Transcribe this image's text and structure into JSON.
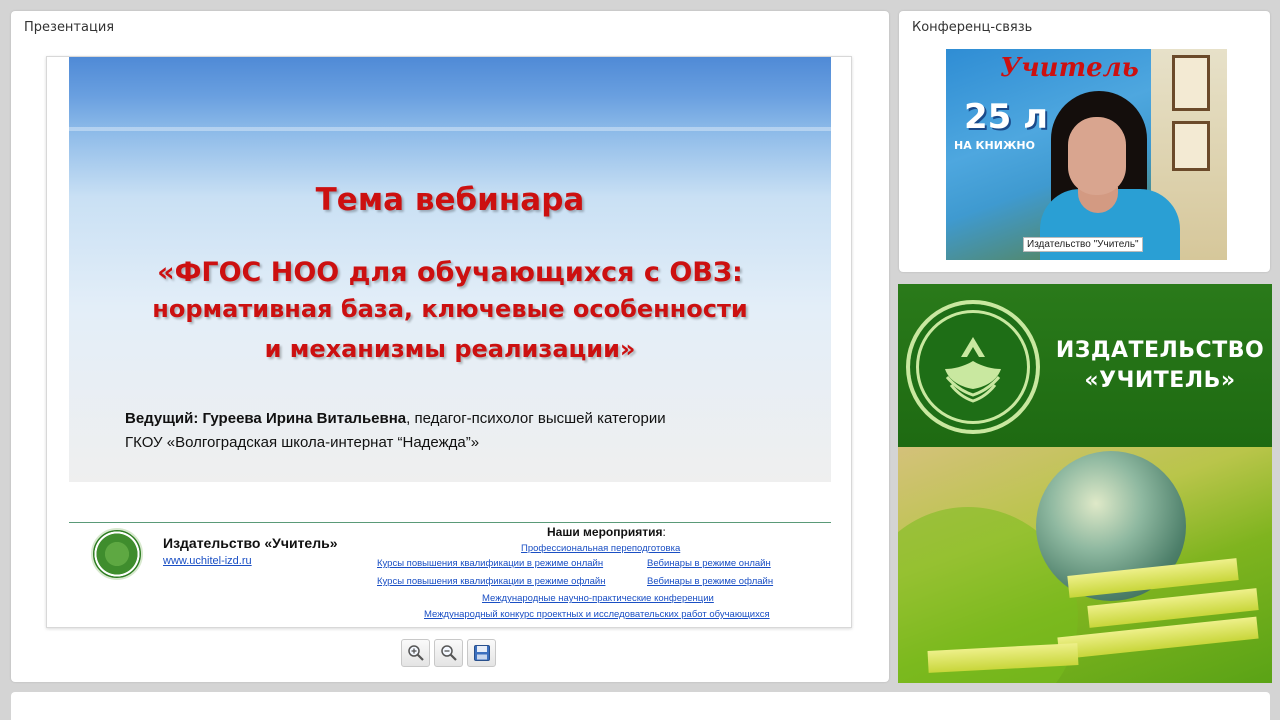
{
  "presentation": {
    "panel_title": "Презентация",
    "slide": {
      "topic": "Тема вебинара",
      "title_line1": "«ФГОС НОО для обучающихся с ОВЗ:",
      "title_line2": "нормативная база, ключевые особенности",
      "title_line3": "и механизмы реализации»",
      "presenter_label": "Ведущий: Гуреева Ирина Витальевна",
      "presenter_role": ", педагог-психолог высшей категории",
      "presenter_org": "ГКОУ «Волгоградская школа-интернат “Надежда”»",
      "footer": {
        "publisher": "Издательство «Учитель»",
        "url": "www.uchitel-izd.ru",
        "events_title": "Наши мероприятия",
        "events_colon": ":",
        "events": [
          "Профессиональная переподготовка",
          "Курсы повышения квалификации в режиме онлайн",
          "Вебинары в режиме онлайн",
          "Курсы повышения квалификации в режиме офлайн",
          "Вебинары в режиме офлайн",
          "Международные научно-практические конференции",
          "Международный конкурс проектных и исследовательских работ обучающихся"
        ]
      }
    },
    "controls": {
      "zoom_in_icon": "zoom-in-icon",
      "zoom_out_icon": "zoom-out-icon",
      "save_icon": "floppy-disk-icon"
    }
  },
  "conference": {
    "panel_title": "Конференц-связь",
    "video": {
      "caption": "Издательство \"Учитель\"",
      "backdrop_logo": "Учитель",
      "backdrop_25": "25 л",
      "backdrop_line": "НА КНИЖНО"
    }
  },
  "banner": {
    "line1": "ИЗДАТЕЛЬСТВО",
    "line2": "«УЧИТЕЛЬ»"
  },
  "colors": {
    "slide_title_red": "#cc1010",
    "banner_green": "#1e6e16",
    "link_blue": "#1a4fc4"
  }
}
